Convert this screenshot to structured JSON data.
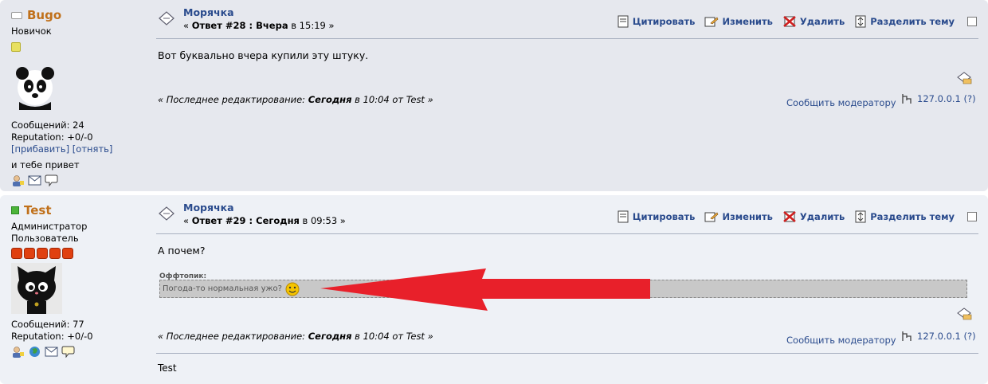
{
  "posts": [
    {
      "username": "Bugo",
      "rank": "Новичок",
      "rank2": "",
      "stats": {
        "messages": "Сообщений: 24",
        "reputation": "Reputation: +0/-0"
      },
      "rep_links": {
        "add": "[прибавить]",
        "remove": "[отнять]"
      },
      "signature_line": "и тебе привет",
      "subject": "Морячка",
      "answer_prefix": "« ",
      "answer_label": "Ответ #28 : Вчера",
      "answer_time": " в 15:19 »",
      "body": "Вот буквально вчера купили эту штуку.",
      "edit": {
        "prefix": "« Последнее редактирование: ",
        "when": "Сегодня",
        "rest": " в 10:04 от Test »"
      },
      "report": "Сообщить модератору",
      "ip": "127.0.0.1 (?)"
    },
    {
      "username": "Test",
      "rank": "Администратор",
      "rank2": "Пользователь",
      "stats": {
        "messages": "Сообщений: 77",
        "reputation": "Reputation: +0/-0"
      },
      "subject": "Морячка",
      "answer_prefix": "« ",
      "answer_label": "Ответ #29 : Сегодня",
      "answer_time": " в 09:53 »",
      "body": "А почем?",
      "offtopic": {
        "label": "Оффтопик:",
        "text": "Погода-то нормальная ужо?"
      },
      "edit": {
        "prefix": "« Последнее редактирование: ",
        "when": "Сегодня",
        "rest": " в 10:04 от Test »"
      },
      "report": "Сообщить модератору",
      "ip": "127.0.0.1 (?)",
      "signature": "Test"
    }
  ],
  "actions": {
    "quote": "Цитировать",
    "modify": "Изменить",
    "delete": "Удалить",
    "split": "Разделить тему"
  },
  "colors": {
    "username": "#c0701a",
    "link": "#2a4b8d",
    "arrow": "#e8202a"
  }
}
